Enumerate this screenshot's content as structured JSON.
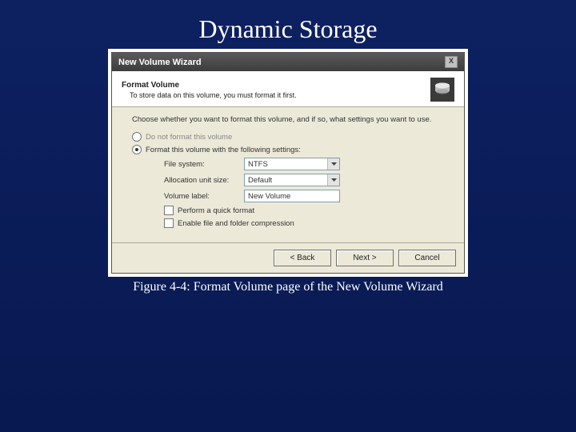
{
  "slide": {
    "title": "Dynamic Storage",
    "caption": "Figure 4-4: Format Volume page of the New Volume Wizard"
  },
  "window": {
    "title": "New Volume Wizard",
    "close_label": "X",
    "header": {
      "title": "Format Volume",
      "subtitle": "To store data on this volume, you must format it first."
    },
    "instruction": "Choose whether you want to format this volume, and if so, what settings you want to use.",
    "options": {
      "no_format": "Do not format this volume",
      "format_with": "Format this volume with the following settings:"
    },
    "fields": {
      "fs_label": "File system:",
      "fs_value": "NTFS",
      "alloc_label": "Allocation unit size:",
      "alloc_value": "Default",
      "vol_label": "Volume label:",
      "vol_value": "New Volume"
    },
    "checks": {
      "quick": "Perform a quick format",
      "compress": "Enable file and folder compression"
    },
    "buttons": {
      "back": "< Back",
      "next": "Next >",
      "cancel": "Cancel"
    }
  }
}
